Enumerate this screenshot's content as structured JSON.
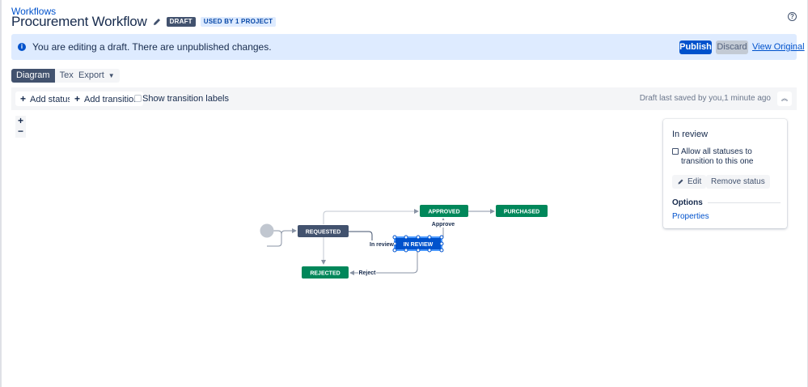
{
  "header": {
    "breadcrumb": "Workflows",
    "title": "Procurement Workflow",
    "draft_badge": "DRAFT",
    "usage_badge": "USED BY 1 PROJECT"
  },
  "banner": {
    "message": "You are editing a draft. There are unpublished changes.",
    "publish_label": "Publish",
    "discard_label": "Discard",
    "view_original_label": "View Original"
  },
  "view_tabs": {
    "diagram_label": "Diagram",
    "text_label": "Text",
    "export_label": "Export"
  },
  "toolbar": {
    "add_status_label": "Add status",
    "add_transition_label": "Add transition",
    "show_labels_label": "Show transition labels",
    "show_labels_checked": false,
    "saved_text": "Draft last saved by you,1 minute ago"
  },
  "zoom": {
    "in_label": "+",
    "out_label": "−"
  },
  "diagram": {
    "statuses": [
      {
        "name": "REQUESTED",
        "category": "todo"
      },
      {
        "name": "IN REVIEW",
        "category": "in-progress",
        "selected": true
      },
      {
        "name": "APPROVED",
        "category": "done"
      },
      {
        "name": "PURCHASED",
        "category": "done"
      },
      {
        "name": "REJECTED",
        "category": "done"
      }
    ],
    "transition_labels": {
      "in_review": "In review",
      "approve": "Approve",
      "reject": "Reject"
    }
  },
  "side_panel": {
    "title": "In review",
    "allow_all_label": "Allow all statuses to transition to this one",
    "allow_all_checked": false,
    "edit_label": "Edit",
    "remove_label": "Remove status",
    "options_heading": "Options",
    "properties_link": "Properties"
  },
  "colors": {
    "accent": "#0052cc",
    "todo": "#42526e",
    "done": "#00875a",
    "banner_bg": "#deebff"
  }
}
